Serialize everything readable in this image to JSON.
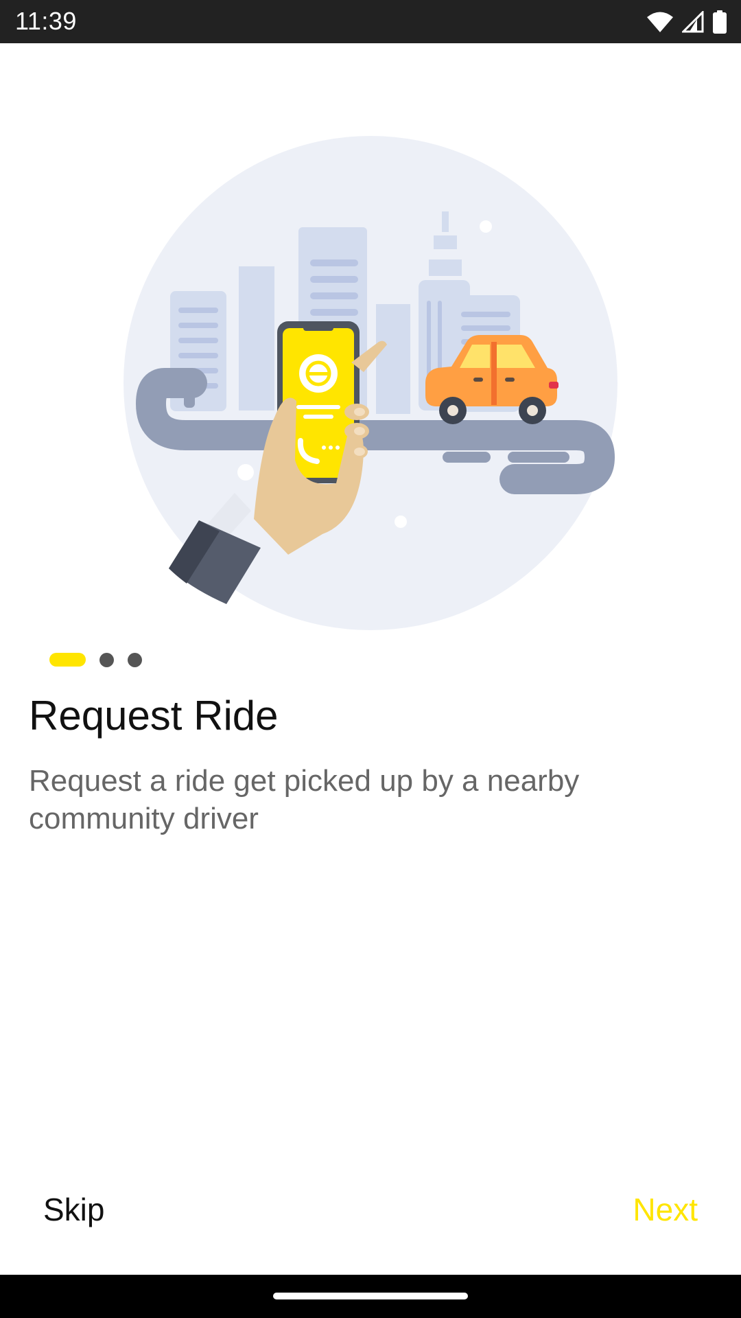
{
  "status_bar": {
    "time": "11:39",
    "icons": [
      "wifi-icon",
      "cell-signal-icon",
      "battery-icon"
    ]
  },
  "onboarding": {
    "illustration": "request-ride-illustration",
    "page_indicator": {
      "current": 1,
      "total": 3
    },
    "title": "Request Ride",
    "description": "Request a ride get picked up by a nearby community driver"
  },
  "actions": {
    "skip_label": "Skip",
    "next_label": "Next"
  },
  "colors": {
    "accent": "#FFE500",
    "title": "#111111",
    "description": "#666666",
    "inactive_dot": "#555555",
    "car": "#FF9F43"
  }
}
